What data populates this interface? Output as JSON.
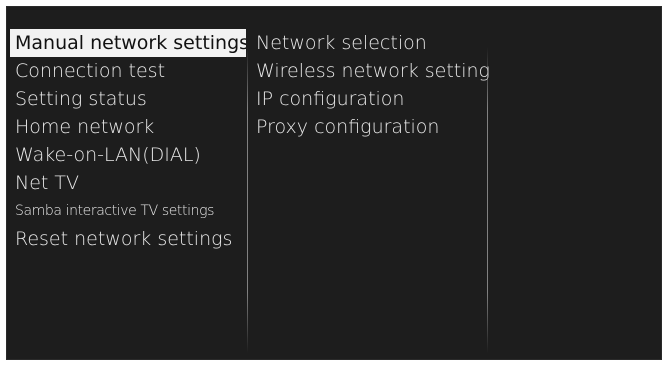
{
  "menu": {
    "items": [
      {
        "label": "Manual network settings"
      },
      {
        "label": "Connection test"
      },
      {
        "label": "Setting status"
      },
      {
        "label": "Home network"
      },
      {
        "label": "Wake-on-LAN(DIAL)"
      },
      {
        "label": "Net TV"
      },
      {
        "label": "Samba interactive TV settings"
      },
      {
        "label": "Reset network settings"
      }
    ],
    "selected_index": 0
  },
  "submenu": {
    "items": [
      {
        "label": "Network selection"
      },
      {
        "label": "Wireless network setting"
      },
      {
        "label": "IP configuration"
      },
      {
        "label": "Proxy configuration"
      }
    ]
  },
  "colors": {
    "background": "#1d1d1d",
    "text": "#e8e8e8",
    "highlight_bg": "#f2f2f2",
    "highlight_text": "#111111"
  }
}
